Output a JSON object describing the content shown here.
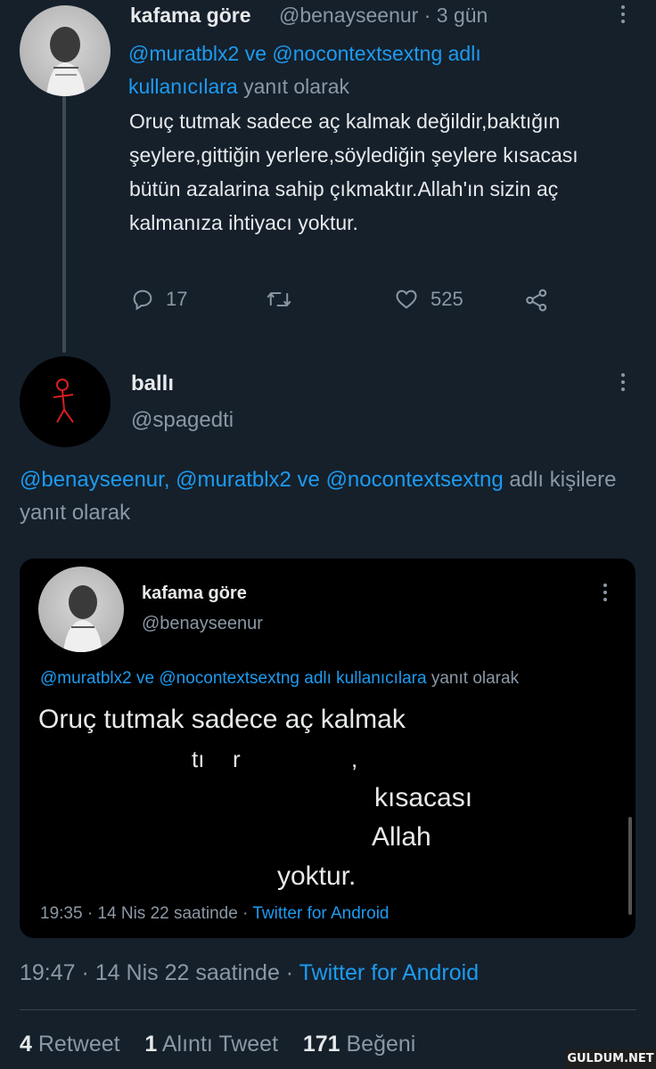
{
  "tweet1": {
    "display_name": "kafama göre",
    "handle_time": "@benayseenur · 3 gün",
    "reply_mentions": "@muratblx2 ve @nocontextsextng adlı kullanıcılara",
    "reply_suffix": "yanıt olarak",
    "body": "Oruç tutmak sadece aç kalmak değildir,baktığın şeylere,gittiğin yerlere,söylediğin şeylere kısacası bütün azalarina sahip çıkmaktır.Allah'ın sizin aç kalmanıza ihtiyacı yoktur.",
    "replies": "17",
    "likes": "525"
  },
  "tweet2": {
    "display_name": "ballı",
    "handle": "@spagedti",
    "reply_mentions": "@benayseenur, @muratblx2 ve @nocontextsextng",
    "reply_suffix": "adlı kişilere yanıt olarak",
    "embed": {
      "display_name": "kafama göre",
      "handle": "@benayseenur",
      "reply_mentions": "@muratblx2 ve @nocontextsextng adlı kullanıcılara",
      "reply_suffix": "yanıt olarak",
      "line1": "Oruç tutmak sadece aç kalmak",
      "line2a": "tı",
      "line2b": "r",
      "line2c": ",",
      "line3": "kısacası",
      "line4": "Allah",
      "line5": "yoktur.",
      "time": "19:35 · 14 Nis 22 saatinde ·",
      "source": "Twitter for Android"
    },
    "time": "19:47 · 14 Nis 22 saatinde ·",
    "source": "Twitter for Android",
    "retweets": "4",
    "retweets_label": "Retweet",
    "quotes": "1",
    "quotes_label": "Alıntı Tweet",
    "likes": "171",
    "likes_label": "Beğeni"
  },
  "watermark": "GULDUM.NET",
  "colors": {
    "background": "#15202b",
    "link": "#1d9bf0",
    "muted": "#8b98a5",
    "text": "#e7e9ea"
  },
  "icons": [
    "reply-icon",
    "retweet-icon",
    "like-icon",
    "share-icon",
    "more-icon"
  ]
}
